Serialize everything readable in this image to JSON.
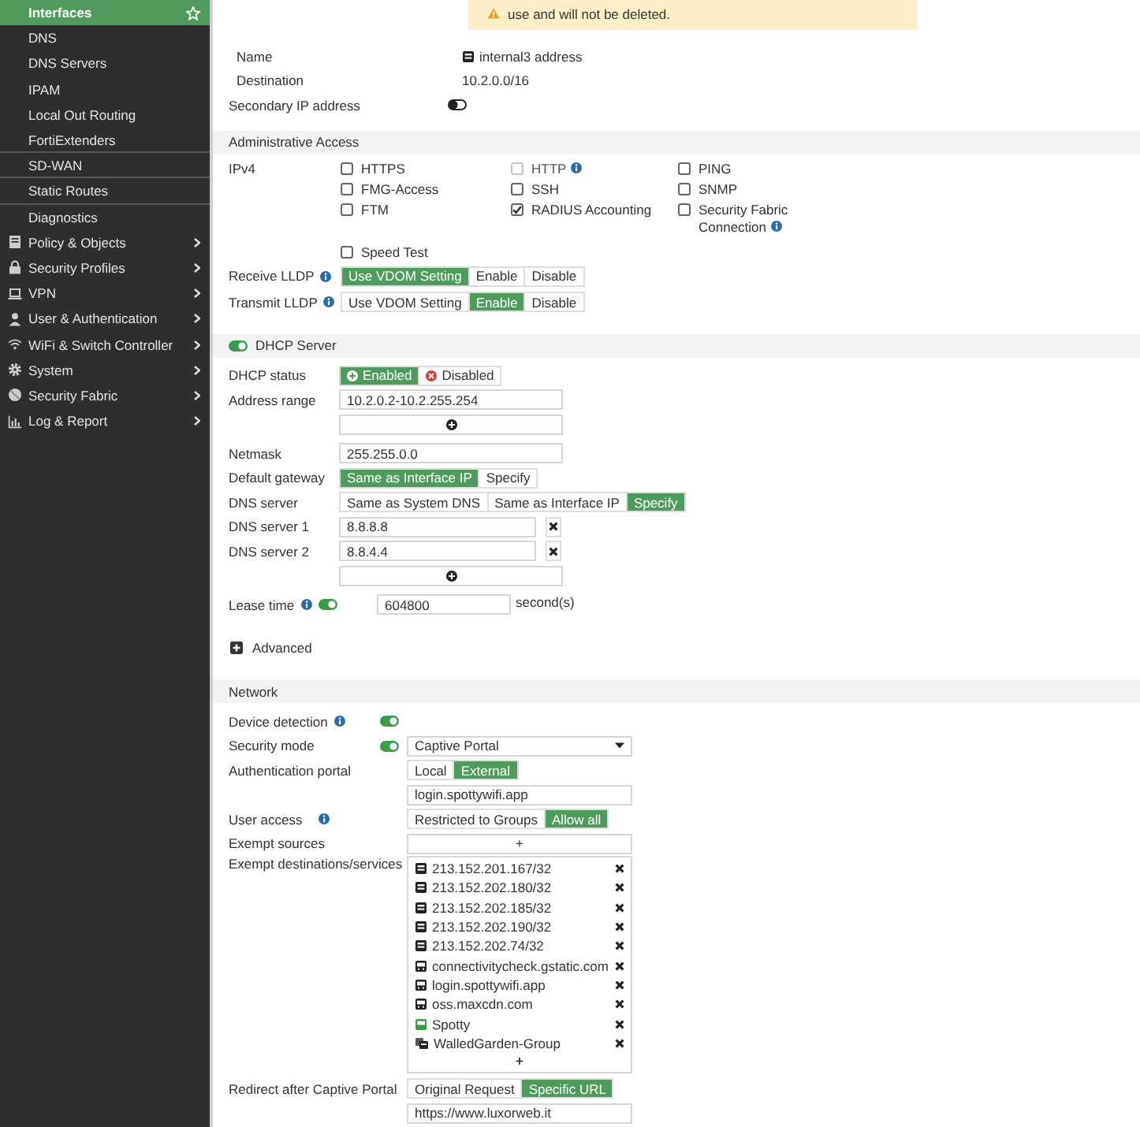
{
  "sidebar": {
    "subitems": [
      {
        "label": "Interfaces",
        "selected": true
      },
      {
        "label": "DNS",
        "selected": false
      },
      {
        "label": "DNS Servers",
        "selected": false
      },
      {
        "label": "IPAM",
        "selected": false
      },
      {
        "label": "Local Out Routing",
        "selected": false
      },
      {
        "label": "FortiExtenders",
        "selected": false
      },
      {
        "label": "SD-WAN",
        "selected": false
      },
      {
        "label": "Static Routes",
        "selected": false
      },
      {
        "label": "Diagnostics",
        "selected": false
      }
    ],
    "menus": [
      {
        "label": "Policy & Objects"
      },
      {
        "label": "Security Profiles"
      },
      {
        "label": "VPN"
      },
      {
        "label": "User & Authentication"
      },
      {
        "label": "WiFi & Switch Controller"
      },
      {
        "label": "System"
      },
      {
        "label": "Security Fabric"
      },
      {
        "label": "Log & Report"
      }
    ]
  },
  "warning": {
    "text": "use and will not be deleted."
  },
  "address": {
    "name_label": "Name",
    "name": "internal3 address",
    "destination_label": "Destination",
    "destination": "10.2.0.0/16"
  },
  "secondary_ip": {
    "label": "Secondary IP address",
    "on": false
  },
  "admin_access": {
    "title": "Administrative Access",
    "ipv4_label": "IPv4",
    "options": [
      {
        "label": "HTTPS",
        "checked": false,
        "disabled": false,
        "info": false
      },
      {
        "label": "HTTP",
        "checked": false,
        "disabled": true,
        "info": true
      },
      {
        "label": "PING",
        "checked": false,
        "disabled": false,
        "info": false
      },
      {
        "label": "FMG-Access",
        "checked": false,
        "disabled": false,
        "info": false
      },
      {
        "label": "SSH",
        "checked": false,
        "disabled": false,
        "info": false
      },
      {
        "label": "SNMP",
        "checked": false,
        "disabled": false,
        "info": false
      },
      {
        "label": "FTM",
        "checked": false,
        "disabled": false,
        "info": false
      },
      {
        "label": "RADIUS Accounting",
        "checked": true,
        "disabled": false,
        "info": false
      },
      {
        "label": "Security Fabric Connection",
        "checked": false,
        "disabled": false,
        "info": true
      },
      {
        "label": "Speed Test",
        "checked": false,
        "disabled": false,
        "info": false
      }
    ]
  },
  "lldp": [
    {
      "label": "Receive LLDP",
      "info": true,
      "options": [
        {
          "label": "Use VDOM Setting",
          "selected": true
        },
        {
          "label": "Enable",
          "selected": false
        },
        {
          "label": "Disable",
          "selected": false
        }
      ]
    },
    {
      "label": "Transmit LLDP",
      "info": true,
      "options": [
        {
          "label": "Use VDOM Setting",
          "selected": false
        },
        {
          "label": "Enable",
          "selected": true
        },
        {
          "label": "Disable",
          "selected": false
        }
      ]
    }
  ],
  "dhcp": {
    "title": "DHCP Server",
    "on": true,
    "status_label": "DHCP status",
    "status": [
      {
        "label": "Enabled",
        "selected": true
      },
      {
        "label": "Disabled",
        "selected": false
      }
    ],
    "address_range_label": "Address range",
    "address_range": "10.2.0.2-10.2.255.254",
    "netmask_label": "Netmask",
    "netmask": "255.255.0.0",
    "gateway_label": "Default gateway",
    "gateway": [
      {
        "label": "Same as Interface IP",
        "selected": true
      },
      {
        "label": "Specify",
        "selected": false
      }
    ],
    "dns_label": "DNS server",
    "dns": [
      {
        "label": "Same as System DNS",
        "selected": false
      },
      {
        "label": "Same as Interface IP",
        "selected": false
      },
      {
        "label": "Specify",
        "selected": true
      }
    ],
    "dns_servers": [
      {
        "label": "DNS server 1",
        "value": "8.8.8.8"
      },
      {
        "label": "DNS server 2",
        "value": "8.8.4.4"
      }
    ],
    "lease_label": "Lease time",
    "lease_on": true,
    "lease": "604800",
    "lease_unit": "second(s)",
    "advanced": "Advanced"
  },
  "network": {
    "title": "Network",
    "device_detection": {
      "label": "Device detection",
      "info": true,
      "on": true
    },
    "security_mode": {
      "label": "Security mode",
      "on": true,
      "value": "Captive Portal"
    },
    "auth_portal": {
      "label": "Authentication portal",
      "options": [
        {
          "label": "Local",
          "selected": false
        },
        {
          "label": "External",
          "selected": true
        }
      ],
      "value": "login.spottywifi.app"
    },
    "user_access": {
      "label": "User access",
      "info": true,
      "options": [
        {
          "label": "Restricted to Groups",
          "selected": false
        },
        {
          "label": "Allow all",
          "selected": true
        }
      ]
    },
    "exempt_sources": {
      "label": "Exempt sources",
      "add": "+"
    },
    "exempt_destinations": {
      "label": "Exempt destinations/services",
      "add": "+",
      "items": [
        {
          "label": "213.152.201.167/32",
          "kind": "subnet"
        },
        {
          "label": "213.152.202.180/32",
          "kind": "subnet"
        },
        {
          "label": "213.152.202.185/32",
          "kind": "subnet"
        },
        {
          "label": "213.152.202.190/32",
          "kind": "subnet"
        },
        {
          "label": "213.152.202.74/32",
          "kind": "subnet"
        },
        {
          "label": "connectivitycheck.gstatic.com",
          "kind": "fqdn"
        },
        {
          "label": "login.spottywifi.app",
          "kind": "fqdn"
        },
        {
          "label": "oss.maxcdn.com",
          "kind": "fqdn"
        },
        {
          "label": "Spotty",
          "kind": "custom"
        },
        {
          "label": "WalledGarden-Group",
          "kind": "group"
        }
      ]
    },
    "redirect": {
      "label": "Redirect after Captive Portal",
      "options": [
        {
          "label": "Original Request",
          "selected": false
        },
        {
          "label": "Specific URL",
          "selected": true
        }
      ],
      "value": "https://www.luxorweb.it"
    }
  }
}
